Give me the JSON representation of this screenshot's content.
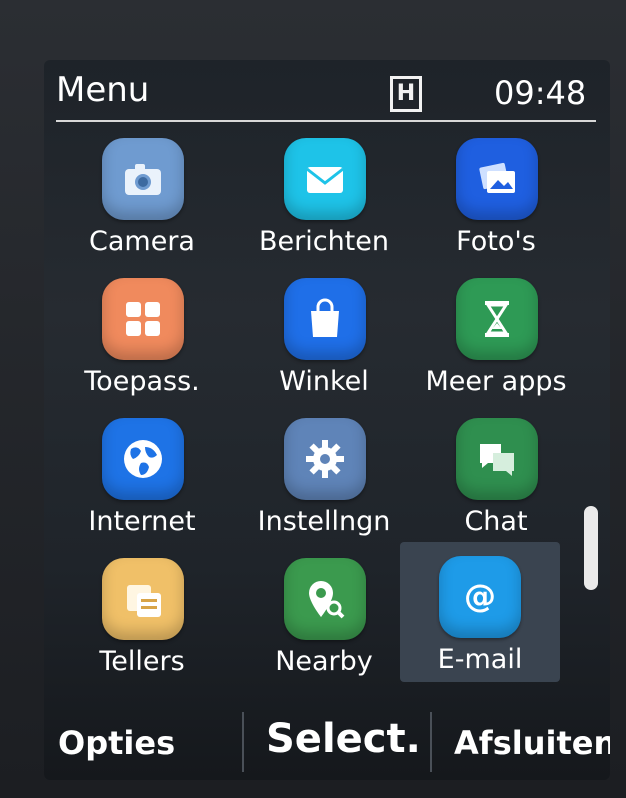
{
  "status": {
    "title": "Menu",
    "indicator": "H",
    "time": "09:48"
  },
  "apps": [
    {
      "label": "Camera",
      "icon": "camera-icon",
      "color": "#6f9bd0"
    },
    {
      "label": "Berichten",
      "icon": "envelope-icon",
      "color": "#1ec3e8"
    },
    {
      "label": "Foto's",
      "icon": "photos-icon",
      "color": "#1f5fe0"
    },
    {
      "label": "Toepass.",
      "icon": "apps-grid-icon",
      "color": "#f08a5d"
    },
    {
      "label": "Winkel",
      "icon": "shopping-bag-icon",
      "color": "#1f6fe8"
    },
    {
      "label": "Meer apps",
      "icon": "hourglass-icon",
      "color": "#2e9a55"
    },
    {
      "label": "Internet",
      "icon": "globe-icon",
      "color": "#1e73e6"
    },
    {
      "label": "Instellngn",
      "icon": "gear-icon",
      "color": "#5f84b8"
    },
    {
      "label": "Chat",
      "icon": "chat-icon",
      "color": "#2f8f4f"
    },
    {
      "label": "Tellers",
      "icon": "counters-icon",
      "color": "#f0c068"
    },
    {
      "label": "Nearby",
      "icon": "location-search-icon",
      "color": "#3b9a4e"
    },
    {
      "label": "E-mail",
      "icon": "at-sign-icon",
      "color": "#1e9be8"
    }
  ],
  "selected_app": "E-mail",
  "softkeys": {
    "left": "Opties",
    "middle": "Select.",
    "right": "Afsluiten"
  }
}
